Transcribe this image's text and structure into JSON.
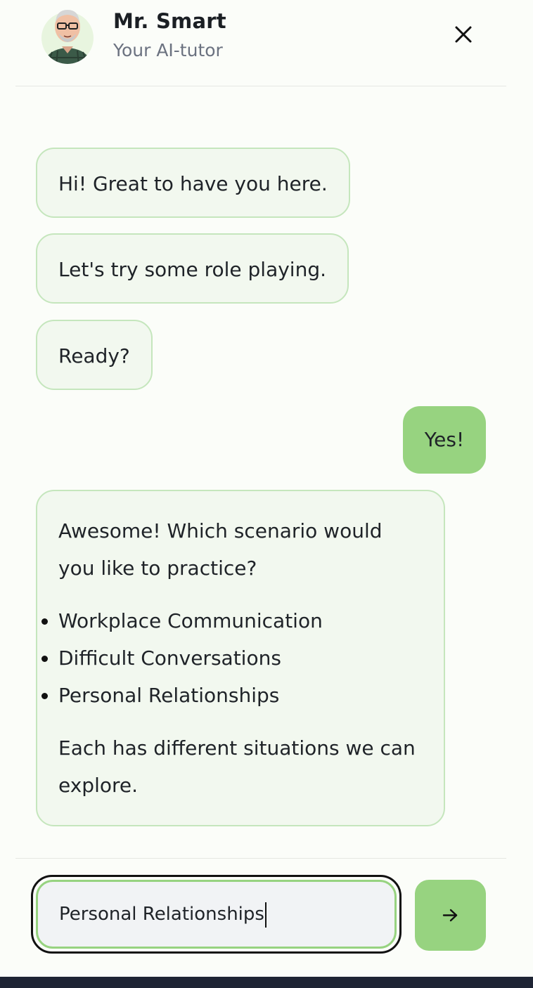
{
  "header": {
    "title": "Mr. Smart",
    "subtitle": "Your AI-tutor",
    "avatar_icon": "tutor-avatar",
    "close_icon": "close-icon"
  },
  "messages": {
    "bot1": "Hi! Great to have you here.",
    "bot2": "Let's try some role playing.",
    "bot3": "Ready?",
    "user1": "Yes!",
    "bot4_intro": "Awesome! Which scenario would you like to practice?",
    "bot4_options": [
      "Workplace Communication",
      "Difficult Conversations",
      "Personal Relationships"
    ],
    "bot4_outro": "Each has different situations we can explore."
  },
  "composer": {
    "input_value": "Personal Relationships",
    "send_icon": "arrow-right-icon"
  },
  "colors": {
    "accent": "#97d380",
    "bot_bubble_bg": "#f2f8ef",
    "bot_bubble_border": "#c5e6bd",
    "page_bg": "#fbfdf9"
  }
}
